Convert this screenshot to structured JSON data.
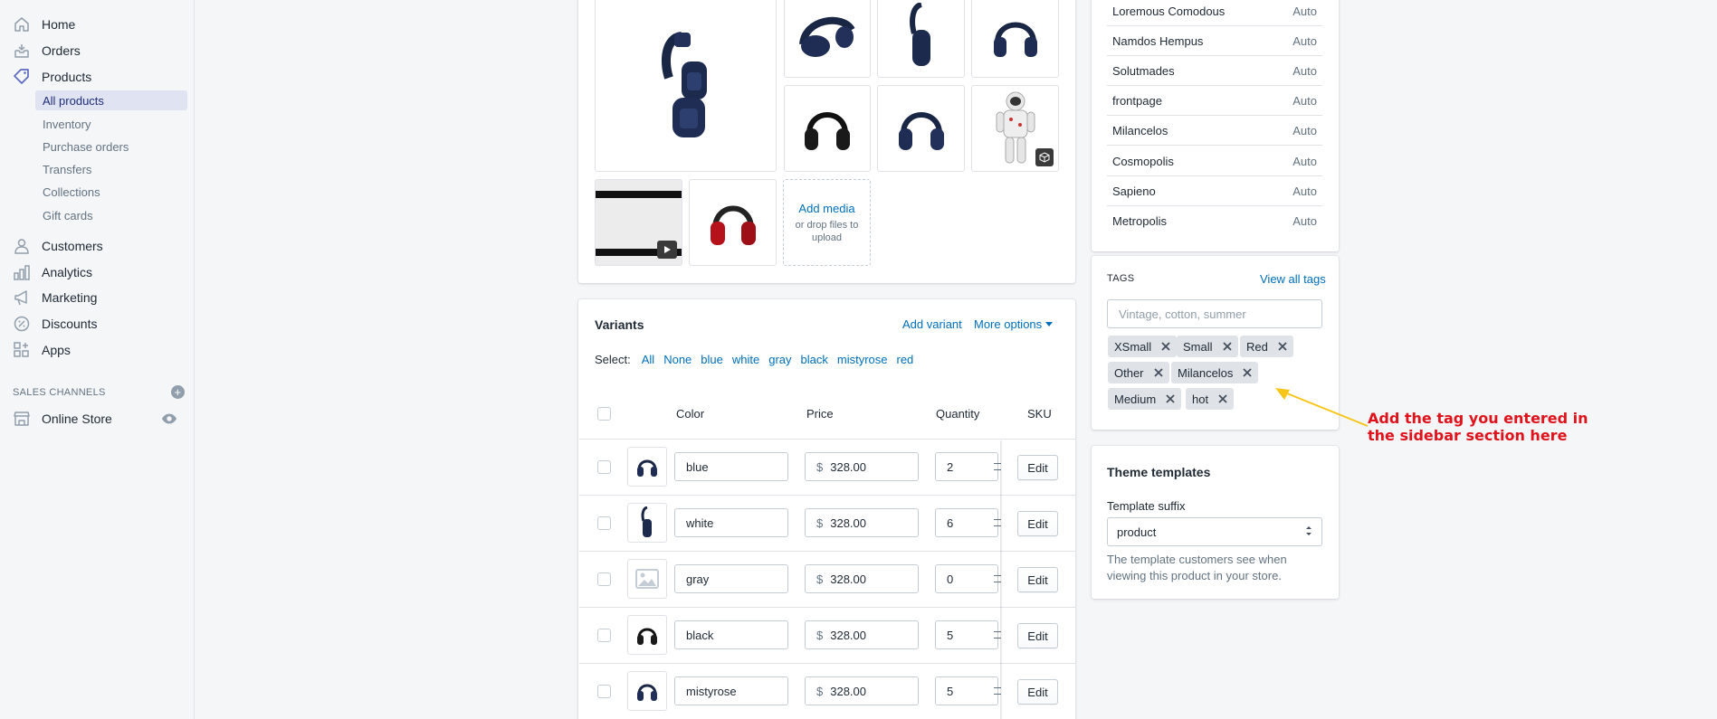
{
  "nav": {
    "home": "Home",
    "orders": "Orders",
    "products": "Products",
    "products_sub": [
      "All products",
      "Inventory",
      "Purchase orders",
      "Transfers",
      "Collections",
      "Gift cards"
    ],
    "customers": "Customers",
    "analytics": "Analytics",
    "marketing": "Marketing",
    "discounts": "Discounts",
    "apps": "Apps",
    "sales_channels": "SALES CHANNELS",
    "online_store": "Online Store"
  },
  "media": {
    "add_media": "Add media",
    "drop_hint": "or drop files to upload"
  },
  "variants": {
    "title": "Variants",
    "add_variant": "Add variant",
    "more_options": "More options",
    "select_label": "Select:",
    "select_options": [
      "All",
      "None",
      "blue",
      "white",
      "gray",
      "black",
      "mistyrose",
      "red"
    ],
    "columns": {
      "color": "Color",
      "price": "Price",
      "quantity": "Quantity",
      "sku": "SKU"
    },
    "currency": "$",
    "edit_label": "Edit",
    "rows": [
      {
        "color": "blue",
        "price": "328.00",
        "quantity": "2"
      },
      {
        "color": "white",
        "price": "328.00",
        "quantity": "6"
      },
      {
        "color": "gray",
        "price": "328.00",
        "quantity": "0"
      },
      {
        "color": "black",
        "price": "328.00",
        "quantity": "5"
      },
      {
        "color": "mistyrose",
        "price": "328.00",
        "quantity": "5"
      }
    ]
  },
  "collections": [
    {
      "name": "Loremous Comodous",
      "mode": "Auto"
    },
    {
      "name": "Namdos Hempus",
      "mode": "Auto"
    },
    {
      "name": "Solutmades",
      "mode": "Auto"
    },
    {
      "name": "frontpage",
      "mode": "Auto"
    },
    {
      "name": "Milancelos",
      "mode": "Auto"
    },
    {
      "name": "Cosmopolis",
      "mode": "Auto"
    },
    {
      "name": "Sapieno",
      "mode": "Auto"
    },
    {
      "name": "Metropolis",
      "mode": "Auto"
    }
  ],
  "tags": {
    "label": "TAGS",
    "view_all": "View all tags",
    "placeholder": "Vintage, cotton, summer",
    "items": [
      "XSmall",
      "Small",
      "Red",
      "Other",
      "Milancelos",
      "Medium",
      "hot"
    ]
  },
  "theme": {
    "title": "Theme templates",
    "suffix_label": "Template suffix",
    "suffix_value": "product",
    "help": "The template customers see when viewing this product in your store."
  },
  "annotation": {
    "text": "Add the tag you entered in the sidebar section here",
    "color": "#e0121b",
    "arrow_color": "#f5c518"
  }
}
